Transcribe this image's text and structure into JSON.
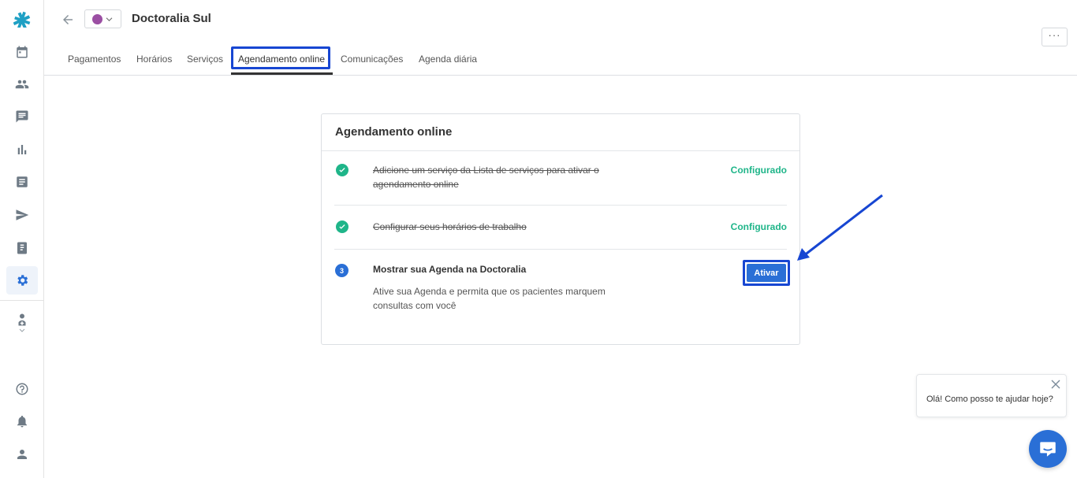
{
  "header": {
    "title": "Doctoralia Sul",
    "more_label": "···",
    "calendar_color": "#9b4fa3"
  },
  "sidebar": {
    "items": [
      {
        "name": "logo-icon"
      },
      {
        "name": "calendar-icon"
      },
      {
        "name": "patients-icon"
      },
      {
        "name": "messages-icon"
      },
      {
        "name": "stats-icon"
      },
      {
        "name": "list-icon"
      },
      {
        "name": "send-icon"
      },
      {
        "name": "notebook-icon"
      },
      {
        "name": "settings-icon",
        "active": true
      },
      {
        "name": "doctor-icon"
      },
      {
        "name": "help-icon"
      },
      {
        "name": "bell-icon"
      },
      {
        "name": "user-icon"
      }
    ]
  },
  "tabs": [
    {
      "label": "Pagamentos"
    },
    {
      "label": "Horários"
    },
    {
      "label": "Serviços"
    },
    {
      "label": "Agendamento online",
      "active": true
    },
    {
      "label": "Comunicações"
    },
    {
      "label": "Agenda diária"
    }
  ],
  "card": {
    "title": "Agendamento online",
    "steps": [
      {
        "text": "Adicione um serviço da Lista de serviços para ativar o agendamento online",
        "status": "Configurado",
        "done": true
      },
      {
        "text": "Configurar seus horários de trabalho",
        "status": "Configurado",
        "done": true
      },
      {
        "number": "3",
        "title": "Mostrar sua Agenda na Doctoralia",
        "description": "Ative sua Agenda e permita que os pacientes marquem consultas com você",
        "button_label": "Ativar",
        "done": false
      }
    ]
  },
  "chat": {
    "message": "Olá! Como posso te ajudar hoje?"
  },
  "colors": {
    "accent": "#2a6fd6",
    "success": "#1fb589",
    "annotation": "#1746d2"
  }
}
